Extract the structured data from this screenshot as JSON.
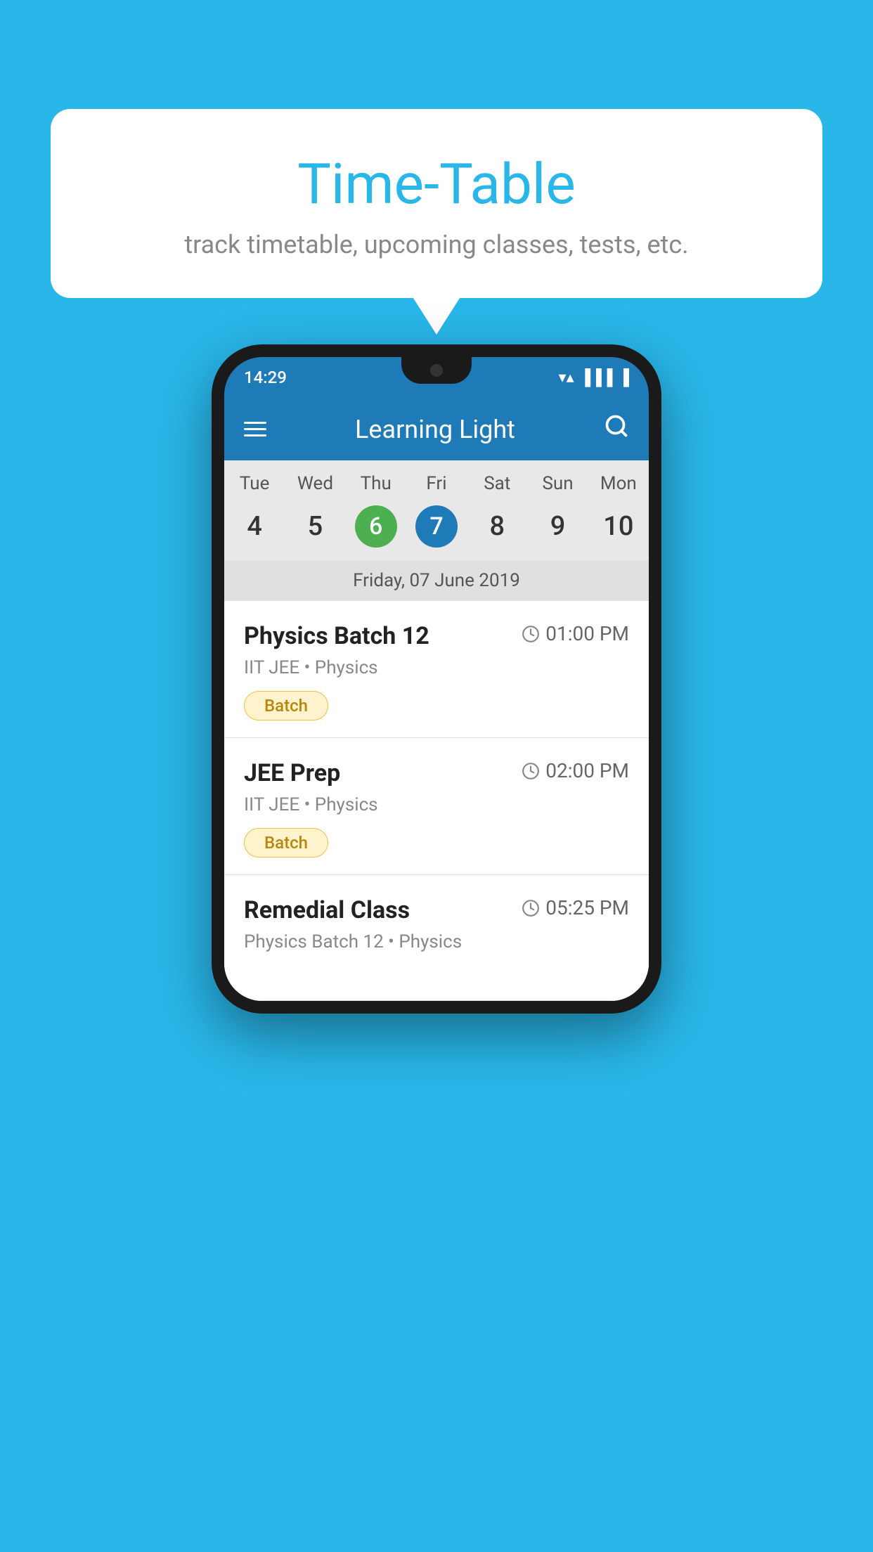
{
  "background": {
    "color": "#29B6E8"
  },
  "bubble": {
    "title": "Time-Table",
    "subtitle": "track timetable, upcoming classes, tests, etc."
  },
  "phone": {
    "status_bar": {
      "time": "14:29"
    },
    "app_header": {
      "title": "Learning Light",
      "search_icon": "🔍"
    },
    "calendar": {
      "days": [
        {
          "label": "Tue",
          "number": "4"
        },
        {
          "label": "Wed",
          "number": "5"
        },
        {
          "label": "Thu",
          "number": "6",
          "state": "today"
        },
        {
          "label": "Fri",
          "number": "7",
          "state": "selected"
        },
        {
          "label": "Sat",
          "number": "8"
        },
        {
          "label": "Sun",
          "number": "9"
        },
        {
          "label": "Mon",
          "number": "10"
        }
      ],
      "selected_date_label": "Friday, 07 June 2019"
    },
    "schedule": [
      {
        "name": "Physics Batch 12",
        "time": "01:00 PM",
        "detail": "IIT JEE • Physics",
        "badge": "Batch"
      },
      {
        "name": "JEE Prep",
        "time": "02:00 PM",
        "detail": "IIT JEE • Physics",
        "badge": "Batch"
      },
      {
        "name": "Remedial Class",
        "time": "05:25 PM",
        "detail": "Physics Batch 12 • Physics",
        "badge": null
      }
    ]
  }
}
